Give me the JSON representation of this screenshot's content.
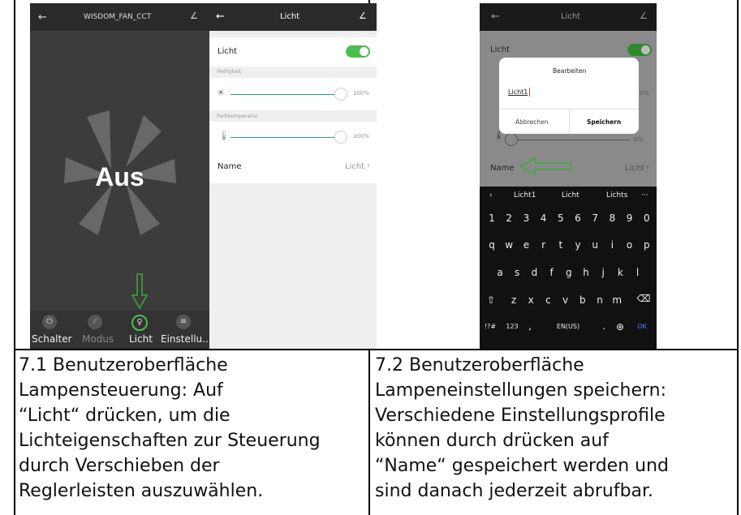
{
  "colors": {
    "accent_green": "#4cbe4f",
    "slider_teal": "#1ea584",
    "arrow_green": "#3aa93a",
    "cursor_red": "#e04a2f"
  },
  "panel1": {
    "title": "WISDOM_FAN_CCT",
    "status": "Aus",
    "nav": [
      {
        "label": "Schalter",
        "icon": "power-icon"
      },
      {
        "label": "Modus",
        "icon": "mode-icon"
      },
      {
        "label": "Licht",
        "icon": "bulb-icon"
      },
      {
        "label": "Einstellu...",
        "icon": "settings-icon"
      }
    ]
  },
  "panel2": {
    "title": "Licht",
    "light_label": "Licht",
    "light_on": true,
    "brightness_label": "Helligkeit",
    "brightness_value": "100%",
    "brightness_level": 1.0,
    "color_temp_label": "Farbtemperatur",
    "color_temp_value": "100%",
    "color_temp_level": 1.0,
    "name_label": "Name",
    "name_value": "Licht"
  },
  "panel3": {
    "title": "Licht",
    "light_label": "Licht",
    "brightness_value_partial": "0%",
    "color_temp_value": "0%",
    "dialog": {
      "title": "Bearbeiten",
      "input_value": "Licht1",
      "cancel": "Abbrechen",
      "save": "Speichern"
    },
    "name_label": "Name",
    "name_value": "Licht",
    "suggestions": [
      "Licht1",
      "Licht",
      "Lichts"
    ],
    "keyboard": {
      "row1": [
        "1",
        "2",
        "3",
        "4",
        "5",
        "6",
        "7",
        "8",
        "9",
        "0"
      ],
      "row2": [
        "q",
        "w",
        "e",
        "r",
        "t",
        "y",
        "u",
        "i",
        "o",
        "p"
      ],
      "row3": [
        "a",
        "s",
        "d",
        "f",
        "g",
        "h",
        "j",
        "k",
        "l"
      ],
      "row4": [
        "z",
        "x",
        "c",
        "v",
        "b",
        "n",
        "m"
      ],
      "sym": "!?#",
      "num": "123",
      "comma": ",",
      "space": "EN(US)",
      "dot": ".",
      "ok": "OK"
    }
  },
  "captions": {
    "left": {
      "title": "7.1 Benutzeroberfläche",
      "lines": [
        "Lampensteuerung:",
        " Auf",
        "“Licht“ drücken, um die",
        "Lichteigenschaften zur Steuerung",
        "durch Verschieben der",
        "Reglerleisten auszuwählen."
      ]
    },
    "right": {
      "title": "7.2 Benutzeroberfläche",
      "lines": [
        "Lampeneinstellungen speichern:",
        "Verschiedene Einstellungsprofile",
        "können durch drücken auf",
        "“Name“ gespeichert werden und",
        "sind danach jederzeit abrufbar."
      ]
    }
  }
}
